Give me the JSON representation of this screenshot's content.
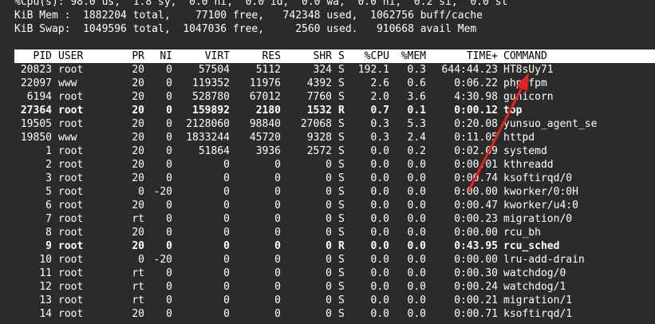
{
  "summary": {
    "cpu_line": "%Cpu(s): 98.0 us,  1.8 sy,  0.0 ni,  0.0 id,  0.0 wa,  0.0 hi,  0.2 si,  0.0 st",
    "mem_line": "KiB Mem :  1882204 total,    77100 free,   742348 used,  1062756 buff/cache",
    "swap_line": "KiB Swap:  1049596 total,  1047036 free,     2560 used.   910668 avail Mem"
  },
  "columns": [
    "PID",
    "USER",
    "PR",
    "NI",
    "VIRT",
    "RES",
    "SHR",
    "S",
    "%CPU",
    "%MEM",
    "TIME+",
    "COMMAND"
  ],
  "processes": [
    {
      "pid": "20823",
      "user": "root",
      "pr": "20",
      "ni": "0",
      "virt": "57504",
      "res": "5112",
      "shr": "324",
      "s": "S",
      "cpu": "192.1",
      "mem": "0.3",
      "time": "644:44.23",
      "cmd": "HT8sUy71",
      "bold": false
    },
    {
      "pid": "22097",
      "user": "www",
      "pr": "20",
      "ni": "0",
      "virt": "119352",
      "res": "11976",
      "shr": "4392",
      "s": "S",
      "cpu": "2.6",
      "mem": "0.6",
      "time": "0:06.22",
      "cmd": "php-fpm",
      "bold": false
    },
    {
      "pid": "6194",
      "user": "root",
      "pr": "20",
      "ni": "0",
      "virt": "528780",
      "res": "67012",
      "shr": "7760",
      "s": "S",
      "cpu": "2.0",
      "mem": "3.6",
      "time": "4:30.98",
      "cmd": "gunicorn",
      "bold": false
    },
    {
      "pid": "27364",
      "user": "root",
      "pr": "20",
      "ni": "0",
      "virt": "159892",
      "res": "2180",
      "shr": "1532",
      "s": "R",
      "cpu": "0.7",
      "mem": "0.1",
      "time": "0:00.12",
      "cmd": "top",
      "bold": true
    },
    {
      "pid": "19505",
      "user": "root",
      "pr": "20",
      "ni": "0",
      "virt": "2128060",
      "res": "98840",
      "shr": "27068",
      "s": "S",
      "cpu": "0.3",
      "mem": "5.3",
      "time": "0:20.08",
      "cmd": "yunsuo_agent_se",
      "bold": false
    },
    {
      "pid": "19850",
      "user": "www",
      "pr": "20",
      "ni": "0",
      "virt": "1833244",
      "res": "45720",
      "shr": "9328",
      "s": "S",
      "cpu": "0.3",
      "mem": "2.4",
      "time": "0:11.05",
      "cmd": "httpd",
      "bold": false
    },
    {
      "pid": "1",
      "user": "root",
      "pr": "20",
      "ni": "0",
      "virt": "51864",
      "res": "3936",
      "shr": "2572",
      "s": "S",
      "cpu": "0.0",
      "mem": "0.2",
      "time": "0:02.09",
      "cmd": "systemd",
      "bold": false
    },
    {
      "pid": "2",
      "user": "root",
      "pr": "20",
      "ni": "0",
      "virt": "0",
      "res": "0",
      "shr": "0",
      "s": "S",
      "cpu": "0.0",
      "mem": "0.0",
      "time": "0:00.01",
      "cmd": "kthreadd",
      "bold": false
    },
    {
      "pid": "3",
      "user": "root",
      "pr": "20",
      "ni": "0",
      "virt": "0",
      "res": "0",
      "shr": "0",
      "s": "S",
      "cpu": "0.0",
      "mem": "0.0",
      "time": "0:00.74",
      "cmd": "ksoftirqd/0",
      "bold": false
    },
    {
      "pid": "5",
      "user": "root",
      "pr": "0",
      "ni": "-20",
      "virt": "0",
      "res": "0",
      "shr": "0",
      "s": "S",
      "cpu": "0.0",
      "mem": "0.0",
      "time": "0:00.00",
      "cmd": "kworker/0:0H",
      "bold": false
    },
    {
      "pid": "6",
      "user": "root",
      "pr": "20",
      "ni": "0",
      "virt": "0",
      "res": "0",
      "shr": "0",
      "s": "S",
      "cpu": "0.0",
      "mem": "0.0",
      "time": "0:00.47",
      "cmd": "kworker/u4:0",
      "bold": false
    },
    {
      "pid": "7",
      "user": "root",
      "pr": "rt",
      "ni": "0",
      "virt": "0",
      "res": "0",
      "shr": "0",
      "s": "S",
      "cpu": "0.0",
      "mem": "0.0",
      "time": "0:00.23",
      "cmd": "migration/0",
      "bold": false
    },
    {
      "pid": "8",
      "user": "root",
      "pr": "20",
      "ni": "0",
      "virt": "0",
      "res": "0",
      "shr": "0",
      "s": "S",
      "cpu": "0.0",
      "mem": "0.0",
      "time": "0:00.00",
      "cmd": "rcu_bh",
      "bold": false
    },
    {
      "pid": "9",
      "user": "root",
      "pr": "20",
      "ni": "0",
      "virt": "0",
      "res": "0",
      "shr": "0",
      "s": "R",
      "cpu": "0.0",
      "mem": "0.0",
      "time": "0:43.95",
      "cmd": "rcu_sched",
      "bold": true
    },
    {
      "pid": "10",
      "user": "root",
      "pr": "0",
      "ni": "-20",
      "virt": "0",
      "res": "0",
      "shr": "0",
      "s": "S",
      "cpu": "0.0",
      "mem": "0.0",
      "time": "0:00.00",
      "cmd": "lru-add-drain",
      "bold": false
    },
    {
      "pid": "11",
      "user": "root",
      "pr": "rt",
      "ni": "0",
      "virt": "0",
      "res": "0",
      "shr": "0",
      "s": "S",
      "cpu": "0.0",
      "mem": "0.0",
      "time": "0:00.30",
      "cmd": "watchdog/0",
      "bold": false
    },
    {
      "pid": "12",
      "user": "root",
      "pr": "rt",
      "ni": "0",
      "virt": "0",
      "res": "0",
      "shr": "0",
      "s": "S",
      "cpu": "0.0",
      "mem": "0.0",
      "time": "0:00.24",
      "cmd": "watchdog/1",
      "bold": false
    },
    {
      "pid": "13",
      "user": "root",
      "pr": "rt",
      "ni": "0",
      "virt": "0",
      "res": "0",
      "shr": "0",
      "s": "S",
      "cpu": "0.0",
      "mem": "0.0",
      "time": "0:00.21",
      "cmd": "migration/1",
      "bold": false
    },
    {
      "pid": "14",
      "user": "root",
      "pr": "20",
      "ni": "0",
      "virt": "0",
      "res": "0",
      "shr": "0",
      "s": "S",
      "cpu": "0.0",
      "mem": "0.0",
      "time": "0:00.71",
      "cmd": "ksoftirqd/1",
      "bold": false
    }
  ],
  "annotation": {
    "color": "#e8231b",
    "icon": "red-arrow-icon"
  },
  "colors": {
    "background": "#2b2b2b",
    "text": "#ffffff",
    "header_bg": "#ffffff",
    "header_text": "#000000"
  }
}
